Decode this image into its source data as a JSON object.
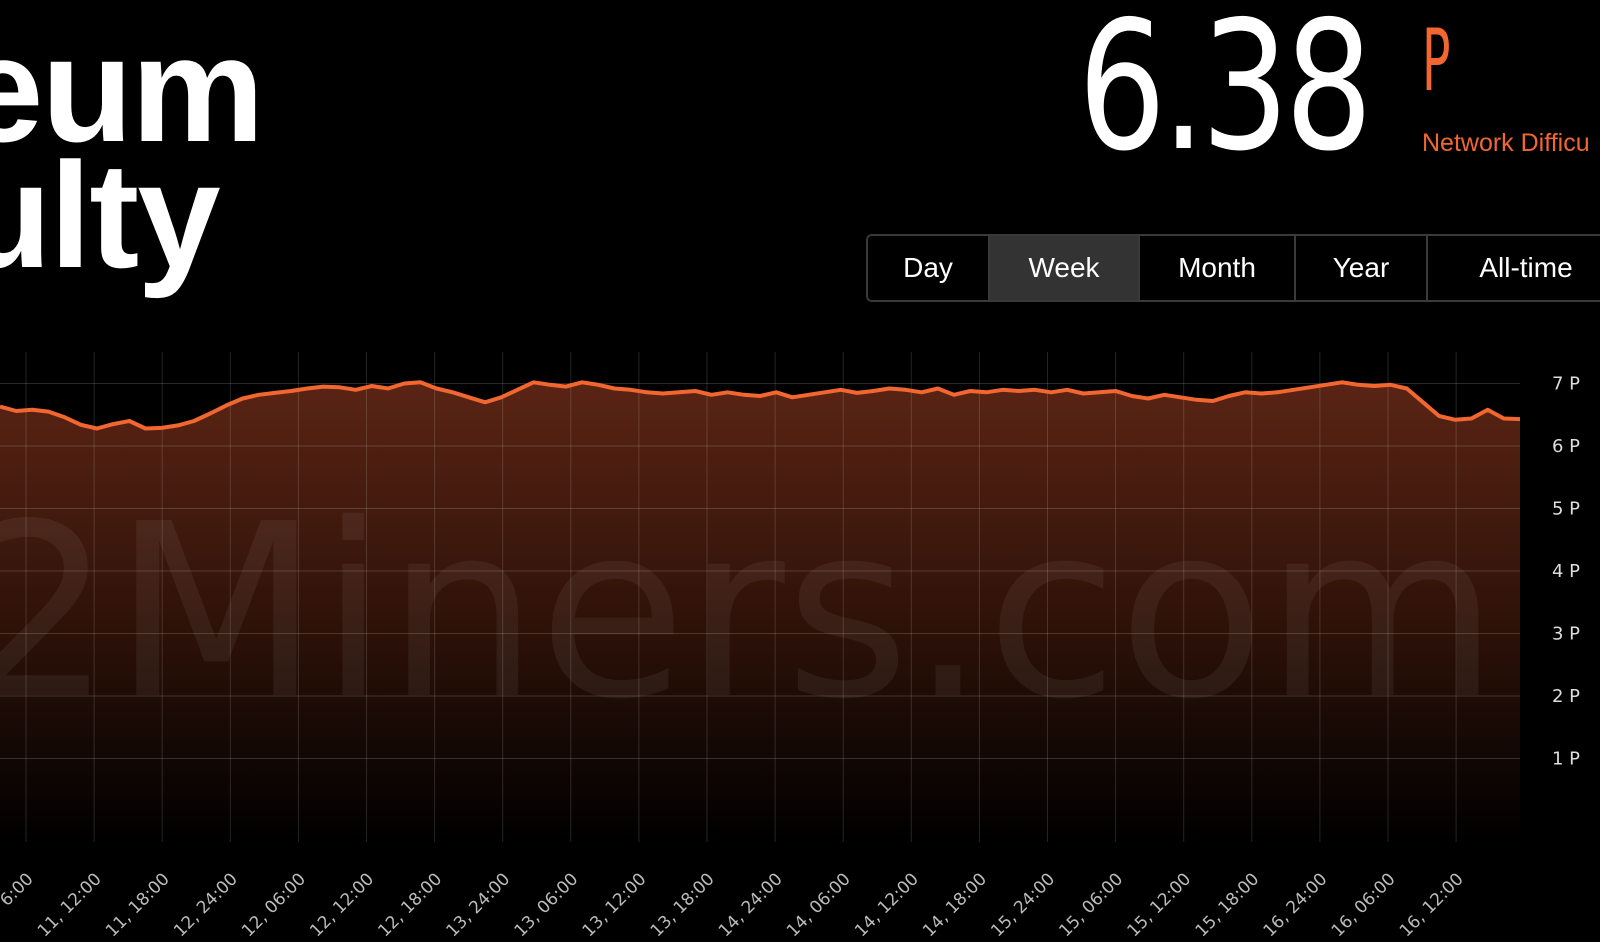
{
  "header": {
    "title_line_1": "eum",
    "title_line_2": "ulty"
  },
  "stat": {
    "value": "6.38",
    "unit": "P",
    "label": "Network Difficu"
  },
  "periods": [
    {
      "label": "Day",
      "active": false
    },
    {
      "label": "Week",
      "active": true
    },
    {
      "label": "Month",
      "active": false
    },
    {
      "label": "Year",
      "active": false
    },
    {
      "label": "All-time",
      "active": false
    }
  ],
  "colors": {
    "accent": "#f26630",
    "area_top": "#5a2414",
    "background": "#000000"
  },
  "chart_data": {
    "type": "area",
    "title": "",
    "watermark": "2Miners.com",
    "ylabel": "",
    "xlabel": "",
    "ylim": [
      0,
      7.4
    ],
    "y_ticks": [
      1,
      2,
      3,
      4,
      5,
      6,
      7
    ],
    "y_tick_labels": [
      "1 P",
      "2 P",
      "3 P",
      "4 P",
      "5 P",
      "6 P",
      "7 P"
    ],
    "grid": true,
    "x_tick_labels": [
      "6:00",
      "11, 12:00",
      "11, 18:00",
      "12, 24:00",
      "12, 06:00",
      "12, 12:00",
      "12, 18:00",
      "13, 24:00",
      "13, 06:00",
      "13, 12:00",
      "13, 18:00",
      "14, 24:00",
      "14, 06:00",
      "14, 12:00",
      "14, 18:00",
      "15, 24:00",
      "15, 06:00",
      "15, 12:00",
      "15, 18:00",
      "16, 24:00",
      "16, 06:00",
      "16, 12:00"
    ],
    "series": [
      {
        "values": [
          6.63,
          6.56,
          6.58,
          6.55,
          6.46,
          6.34,
          6.28,
          6.35,
          6.4,
          6.28,
          6.29,
          6.33,
          6.4,
          6.52,
          6.65,
          6.76,
          6.82,
          6.85,
          6.88,
          6.92,
          6.95,
          6.94,
          6.9,
          6.96,
          6.92,
          7.0,
          7.02,
          6.92,
          6.86,
          6.78,
          6.7,
          6.78,
          6.9,
          7.02,
          6.98,
          6.95,
          7.02,
          6.98,
          6.92,
          6.9,
          6.86,
          6.84,
          6.86,
          6.88,
          6.82,
          6.86,
          6.82,
          6.8,
          6.86,
          6.78,
          6.82,
          6.86,
          6.9,
          6.85,
          6.88,
          6.92,
          6.9,
          6.86,
          6.92,
          6.82,
          6.88,
          6.86,
          6.9,
          6.88,
          6.9,
          6.86,
          6.9,
          6.84,
          6.86,
          6.88,
          6.8,
          6.76,
          6.82,
          6.78,
          6.74,
          6.72,
          6.8,
          6.86,
          6.84,
          6.86,
          6.9,
          6.94,
          6.98,
          7.02,
          6.98,
          6.96,
          6.98,
          6.92,
          6.7,
          6.48,
          6.42,
          6.44,
          6.58,
          6.44,
          6.43
        ]
      }
    ]
  }
}
